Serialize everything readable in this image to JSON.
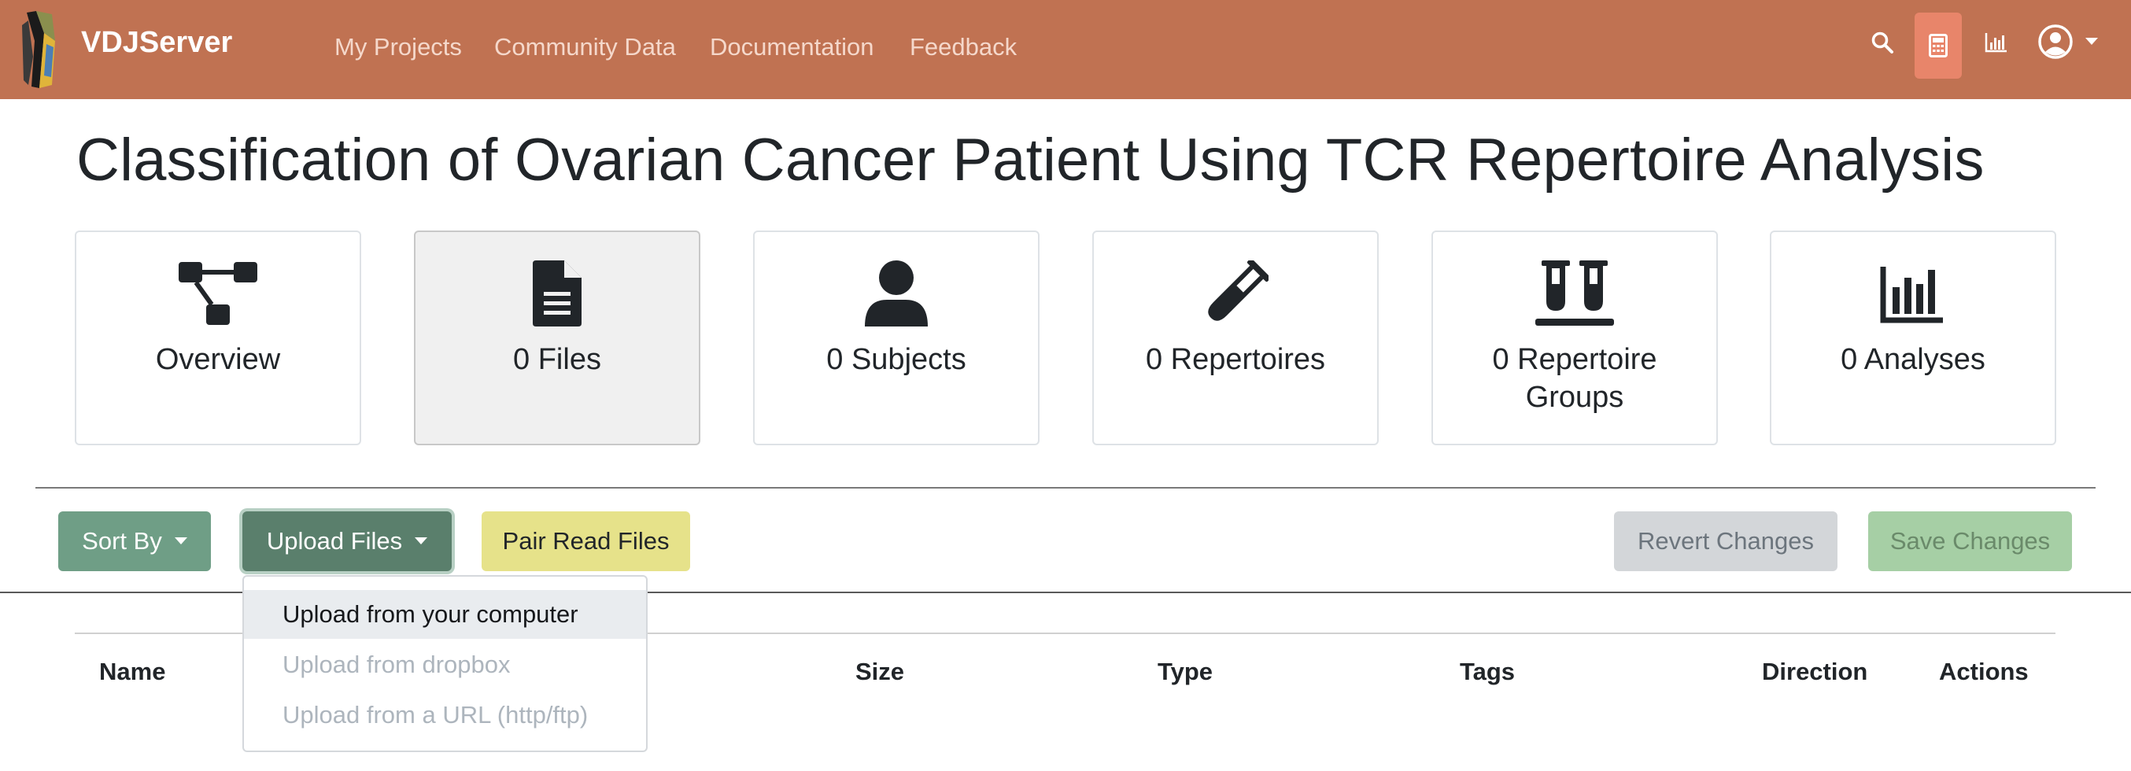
{
  "navbar": {
    "brand": "VDJServer",
    "links": [
      "My Projects",
      "Community Data",
      "Documentation",
      "Feedback"
    ],
    "icons": [
      "search-icon",
      "calculator-icon",
      "chart-bar-icon",
      "user-circle-icon",
      "caret-down-icon"
    ]
  },
  "page": {
    "title": "Classification of Ovarian Cancer Patient Using TCR Repertoire Analysis"
  },
  "cards": [
    {
      "label": "Overview",
      "icon": "sitemap-icon"
    },
    {
      "label": "0 Files",
      "icon": "file-icon"
    },
    {
      "label": "0 Subjects",
      "icon": "user-icon"
    },
    {
      "label": "0 Repertoires",
      "icon": "vial-icon"
    },
    {
      "label": "0 Repertoire Groups",
      "icon": "vials-icon"
    },
    {
      "label": "0 Analyses",
      "icon": "chart-bar-icon"
    }
  ],
  "toolbar": {
    "sort_by": "Sort By",
    "upload_files": "Upload Files",
    "pair_read_files": "Pair Read Files",
    "revert_changes": "Revert Changes",
    "save_changes": "Save Changes"
  },
  "upload_menu": {
    "items": [
      {
        "label": "Upload from your computer",
        "state": "hover"
      },
      {
        "label": "Upload from dropbox",
        "state": "disabled"
      },
      {
        "label": "Upload from a URL (http/ftp)",
        "state": "disabled"
      }
    ]
  },
  "table": {
    "columns": [
      "Name",
      "Size",
      "Type",
      "Tags",
      "Direction",
      "Actions"
    ]
  },
  "colors": {
    "navbar": "#c07252",
    "nav_active": "#e8856a",
    "sort_button": "#6f9e86",
    "upload_button": "#5a7f6c",
    "pair_button": "#e6e28a",
    "revert_button": "#d3d6d9",
    "save_button": "#a6cfa5"
  }
}
